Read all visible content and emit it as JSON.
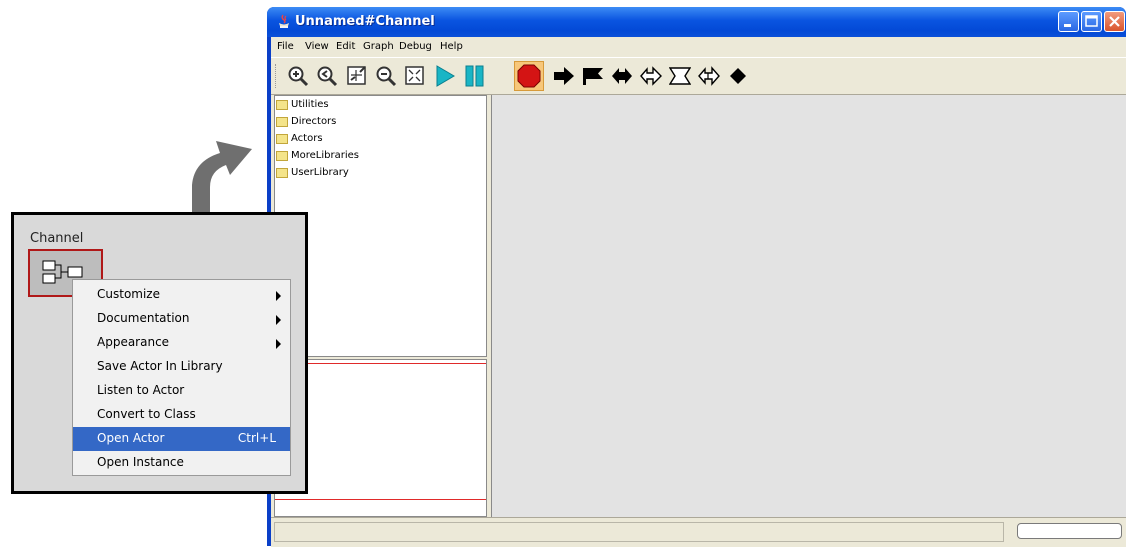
{
  "window": {
    "title": "Unnamed#Channel",
    "menus": [
      "File",
      "View",
      "Edit",
      "Graph",
      "Debug",
      "Help"
    ]
  },
  "toolbar": {
    "icons": [
      "zoom-in-icon",
      "zoom-reset-icon",
      "zoom-fit-icon",
      "zoom-out-icon",
      "full-screen-icon",
      "run-icon",
      "pause-icon",
      "stop-icon",
      "forward-arrow-icon",
      "flag-icon",
      "double-arrow-icon",
      "hollow-arrow-icon",
      "hollow-flag-icon",
      "hollow-double-arrow-icon",
      "diamond-icon"
    ]
  },
  "library": {
    "items": [
      "Utilities",
      "Directors",
      "Actors",
      "MoreLibraries",
      "UserLibrary"
    ]
  },
  "inset": {
    "title": "Channel",
    "menu": [
      {
        "label": "Customize",
        "submenu": true
      },
      {
        "label": "Documentation",
        "submenu": true
      },
      {
        "label": "Appearance",
        "submenu": true
      },
      {
        "label": "Save Actor In Library"
      },
      {
        "label": "Listen to Actor"
      },
      {
        "label": "Convert to Class"
      },
      {
        "label": "Open Actor",
        "shortcut": "Ctrl+L",
        "selected": true
      },
      {
        "label": "Open Instance"
      }
    ]
  },
  "colors": {
    "titlebar": "#0a54e0",
    "selection": "#3468c6",
    "actor_border": "#b01818",
    "stop_button": "#d41414"
  }
}
